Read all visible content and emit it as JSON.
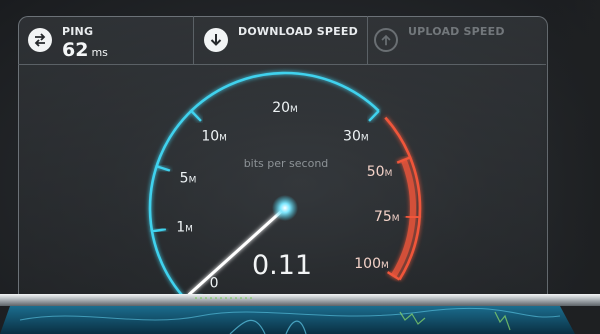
{
  "ping": {
    "label": "PING",
    "value": "62",
    "unit": "ms"
  },
  "download": {
    "label": "DOWNLOAD SPEED"
  },
  "upload": {
    "label": "UPLOAD SPEED"
  },
  "gauge": {
    "caption": "bits per second",
    "reading": "0.11",
    "needle_value_mbps": 0.11,
    "ticks": [
      "0",
      "1M",
      "5M",
      "10M",
      "20M",
      "30M",
      "50M",
      "75M",
      "100M"
    ],
    "colors": {
      "normal": "#3fd2ee",
      "high": "#f0563a",
      "needle": "#ffffff"
    }
  },
  "icons": {
    "ping": "swap-arrows-icon",
    "download": "download-arrow-icon",
    "upload": "upload-arrow-icon"
  }
}
